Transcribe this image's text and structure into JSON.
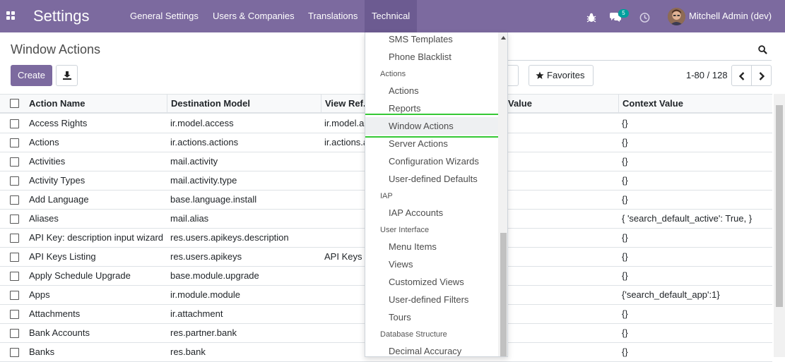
{
  "navbar": {
    "app_title": "Settings",
    "menus": [
      "General Settings",
      "Users & Companies",
      "Translations",
      "Technical"
    ],
    "active_menu": "Technical",
    "chat_count": "5",
    "user_name": "Mitchell Admin (dev)",
    "icons": [
      "apps-icon",
      "bug-icon",
      "chat-icon",
      "clock-icon"
    ]
  },
  "control_panel": {
    "breadcrumb": "Window Actions",
    "create_label": "Create",
    "favorites_label": "Favorites",
    "pager_text": "1-80 / 128"
  },
  "table": {
    "columns": [
      "Action Name",
      "Destination Model",
      "View Ref.",
      "Value",
      "Context Value"
    ],
    "rows": [
      [
        "Access Rights",
        "ir.model.access",
        "ir.model.a",
        "",
        "{}"
      ],
      [
        "Actions",
        "ir.actions.actions",
        "ir.actions.a",
        "",
        "{}"
      ],
      [
        "Activities",
        "mail.activity",
        "",
        "",
        "{}"
      ],
      [
        "Activity Types",
        "mail.activity.type",
        "",
        "",
        "{}"
      ],
      [
        "Add Language",
        "base.language.install",
        "",
        "",
        "{}"
      ],
      [
        "Aliases",
        "mail.alias",
        "",
        "",
        "{ 'search_default_active': True, }"
      ],
      [
        "API Key: description input wizard",
        "res.users.apikeys.description",
        "",
        "",
        "{}"
      ],
      [
        "API Keys Listing",
        "res.users.apikeys",
        "API Keys",
        "",
        "{}"
      ],
      [
        "Apply Schedule Upgrade",
        "base.module.upgrade",
        "",
        "",
        "{}"
      ],
      [
        "Apps",
        "ir.module.module",
        "",
        "",
        "{'search_default_app':1}"
      ],
      [
        "Attachments",
        "ir.attachment",
        "",
        "",
        "{}"
      ],
      [
        "Bank Accounts",
        "res.partner.bank",
        "",
        "",
        "{}"
      ],
      [
        "Banks",
        "res.bank",
        "",
        "",
        "{}"
      ]
    ]
  },
  "dropdown": {
    "items": [
      {
        "type": "item",
        "label": "SMS Templates"
      },
      {
        "type": "item",
        "label": "Phone Blacklist"
      },
      {
        "type": "header",
        "label": "Actions"
      },
      {
        "type": "item",
        "label": "Actions"
      },
      {
        "type": "item",
        "label": "Reports"
      },
      {
        "type": "item",
        "label": "Window Actions",
        "selected": true
      },
      {
        "type": "item",
        "label": "Server Actions"
      },
      {
        "type": "item",
        "label": "Configuration Wizards"
      },
      {
        "type": "item",
        "label": "User-defined Defaults"
      },
      {
        "type": "header",
        "label": "IAP"
      },
      {
        "type": "item",
        "label": "IAP Accounts"
      },
      {
        "type": "header",
        "label": "User Interface"
      },
      {
        "type": "item",
        "label": "Menu Items"
      },
      {
        "type": "item",
        "label": "Views"
      },
      {
        "type": "item",
        "label": "Customized Views"
      },
      {
        "type": "item",
        "label": "User-defined Filters"
      },
      {
        "type": "item",
        "label": "Tours"
      },
      {
        "type": "header",
        "label": "Database Structure"
      },
      {
        "type": "item",
        "label": "Decimal Accuracy"
      }
    ]
  },
  "colors": {
    "brand": "#7c6a9f",
    "highlight": "#35c835",
    "badge": "#00a09d"
  }
}
